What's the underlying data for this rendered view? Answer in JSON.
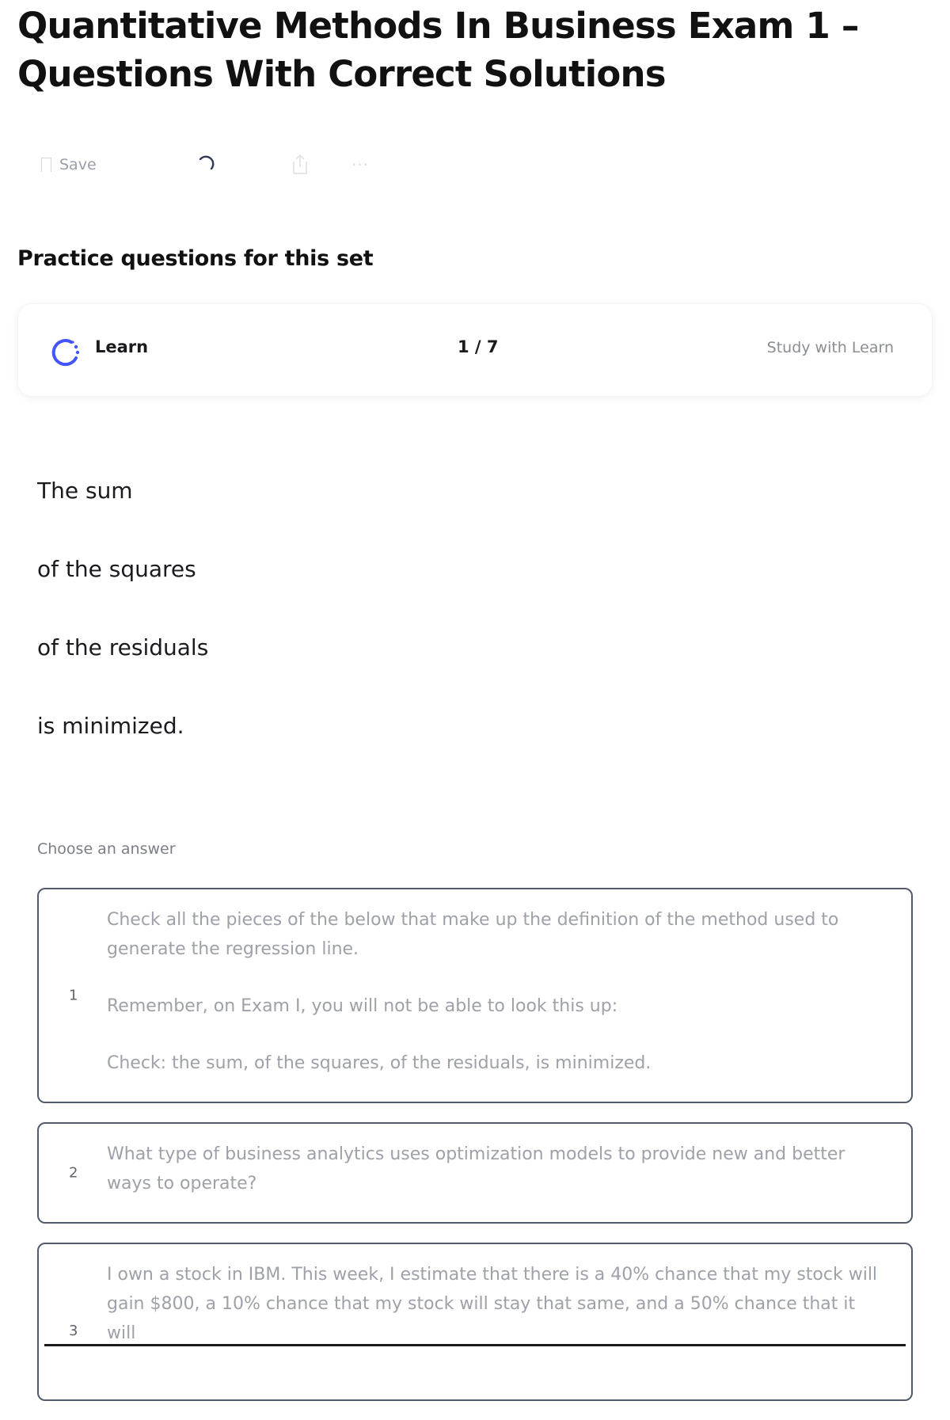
{
  "page": {
    "title": "Quantitative Methods In Business Exam 1 – Questions With Correct Solutions"
  },
  "toolbar": {
    "save_label": "Save",
    "icons": {
      "save": "bookmark-icon",
      "loading": "spinner-icon",
      "share": "share-icon",
      "more": "more-dots-icon"
    }
  },
  "practice": {
    "heading": "Practice questions for this set",
    "card": {
      "mode_label": "Learn",
      "counter": "1 / 7",
      "cta": "Study with Learn",
      "icon": "learn-progress-icon",
      "accent_color": "#4255ff"
    },
    "term_lines": [
      "The sum",
      "of the squares",
      "of the residuals",
      "is minimized."
    ],
    "choose_label": "Choose an answer",
    "options": [
      {
        "number": "1",
        "paragraphs": [
          "Check all the pieces of the below that make up the definition of the method used to generate the regression line.",
          "Remember, on Exam I, you will not be able to look this up:",
          "Check: the sum, of the squares, of the residuals, is minimized."
        ]
      },
      {
        "number": "2",
        "paragraphs": [
          "What type of business analytics uses optimization models to provide new and better ways to operate?"
        ]
      },
      {
        "number": "3",
        "paragraphs": [
          "I own a stock in IBM. This week, I estimate that there is a 40% chance that my stock will gain $800, a 10% chance that my stock will stay that same, and a 50% chance that it will"
        ]
      }
    ]
  }
}
